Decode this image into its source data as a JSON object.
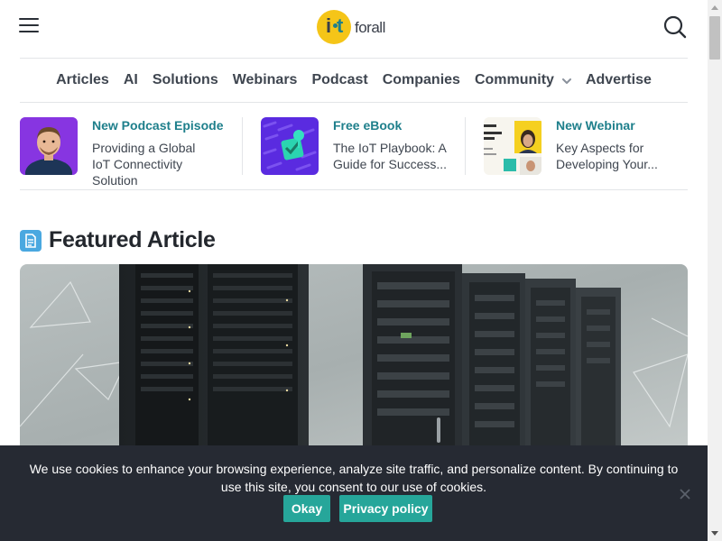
{
  "brand": {
    "logo_text_forall": "forall",
    "logo_letters": "iot",
    "accent_color": "#1e7f8b",
    "logo_yellow": "#f5c518"
  },
  "header": {
    "menu_icon": "hamburger-menu-icon",
    "search_icon": "search-icon"
  },
  "nav": {
    "items": [
      {
        "label": "Articles"
      },
      {
        "label": "AI"
      },
      {
        "label": "Solutions"
      },
      {
        "label": "Webinars"
      },
      {
        "label": "Podcast"
      },
      {
        "label": "Companies"
      },
      {
        "label": "Community"
      },
      {
        "label": "Advertise"
      }
    ]
  },
  "promos": [
    {
      "kicker": "New Podcast Episode",
      "title": "Providing a Global IoT Connectivity Solution"
    },
    {
      "kicker": "Free eBook",
      "title": "The IoT Playbook: A Guide for Success..."
    },
    {
      "kicker": "New Webinar",
      "title": "Key Aspects for Developing Your..."
    }
  ],
  "featured": {
    "heading": "Featured Article",
    "icon": "document-icon"
  },
  "cookie": {
    "text": "We use cookies to enhance your browsing experience, analyze site traffic, and personalize content. By continuing to use this site, you consent to our use of cookies.",
    "okay_label": "Okay",
    "privacy_label": "Privacy policy",
    "button_color": "#26a69a",
    "banner_color": "#262a33"
  }
}
